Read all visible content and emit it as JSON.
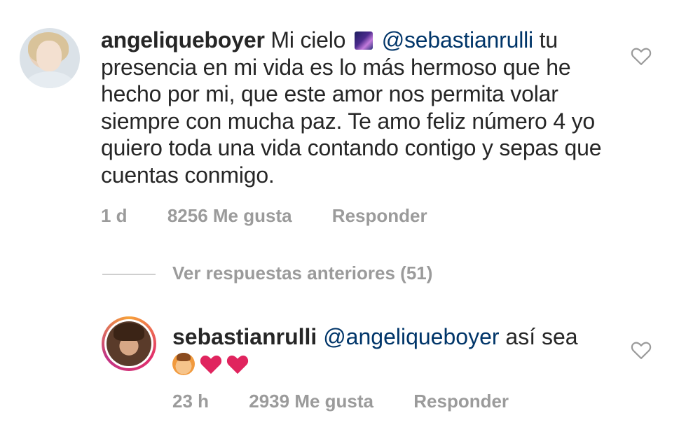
{
  "comment1": {
    "username": "angeliqueboyer",
    "text_before_emoji": "Mi cielo",
    "emoji": "milky-way-emoji",
    "mention": "@sebastianrulli",
    "text_after_mention": " tu presencia en mi vida es lo más hermoso que he hecho por mi, que este amor nos permita volar siempre con mucha paz. Te amo feliz número 4 yo quiero toda una vida contando contigo y sepas que cuentas conmigo.",
    "time": "1 d",
    "likes": "8256 Me gusta",
    "reply": "Responder",
    "like_icon": "heart-outline-icon"
  },
  "replies": {
    "view_previous": "Ver respuestas anteriores (51)"
  },
  "comment2": {
    "username": "sebastianrulli",
    "mention": "@angeliqueboyer",
    "text": " así sea",
    "emojis": [
      "face-emoji",
      "red-heart-emoji",
      "red-heart-emoji"
    ],
    "time": "23 h",
    "likes": "2939 Me gusta",
    "reply": "Responder",
    "like_icon": "heart-outline-icon"
  },
  "colors": {
    "text": "#262626",
    "mention": "#003569",
    "meta": "#9b9b9b",
    "heart_emoji": "#e0245e"
  }
}
